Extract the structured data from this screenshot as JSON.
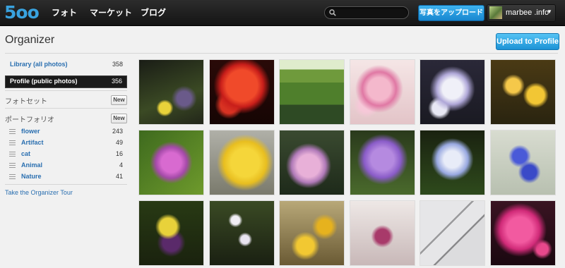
{
  "header": {
    "logo": "5oo",
    "nav": [
      "フォト",
      "マーケット",
      "ブログ"
    ],
    "search_placeholder": "",
    "upload_button": "写真をアップロード",
    "username": "marbee .info"
  },
  "page": {
    "title": "Organizer",
    "upload_profile_button": "Upload to Profile"
  },
  "sidebar": {
    "library": {
      "label": "Library (all photos)",
      "count": "358"
    },
    "profile": {
      "label": "Profile (public photos)",
      "count": "356"
    },
    "photosets": {
      "label": "フォトセット",
      "new": "New"
    },
    "portfolio": {
      "label": "ポートフォリオ",
      "new": "New"
    },
    "portfolio_items": [
      {
        "label": "flower",
        "count": "243"
      },
      {
        "label": "Artifact",
        "count": "49"
      },
      {
        "label": "cat",
        "count": "16"
      },
      {
        "label": "Animal",
        "count": "4"
      },
      {
        "label": "Nature",
        "count": "41"
      }
    ],
    "tour_link": "Take the Organizer Tour"
  },
  "photos": [
    {
      "name": "yellow-wildflowers-dark"
    },
    {
      "name": "red-poppy"
    },
    {
      "name": "willow-pond"
    },
    {
      "name": "pink-cherry-blossoms"
    },
    {
      "name": "white-daisies"
    },
    {
      "name": "yellow-buttercups"
    },
    {
      "name": "purple-daisy"
    },
    {
      "name": "yellow-daisy-closeup"
    },
    {
      "name": "pink-tulip"
    },
    {
      "name": "purple-phlox"
    },
    {
      "name": "white-iris"
    },
    {
      "name": "blue-bluebells"
    },
    {
      "name": "yellow-purple-iris"
    },
    {
      "name": "white-wildflowers"
    },
    {
      "name": "yellow-flowers-bokeh"
    },
    {
      "name": "magnolia-buds"
    },
    {
      "name": "bare-tree-branches"
    },
    {
      "name": "pink-tulip-dark"
    }
  ],
  "colors": {
    "accent": "#39a2de",
    "link": "#2a6fb0",
    "button_blue": "#1c93d6"
  }
}
